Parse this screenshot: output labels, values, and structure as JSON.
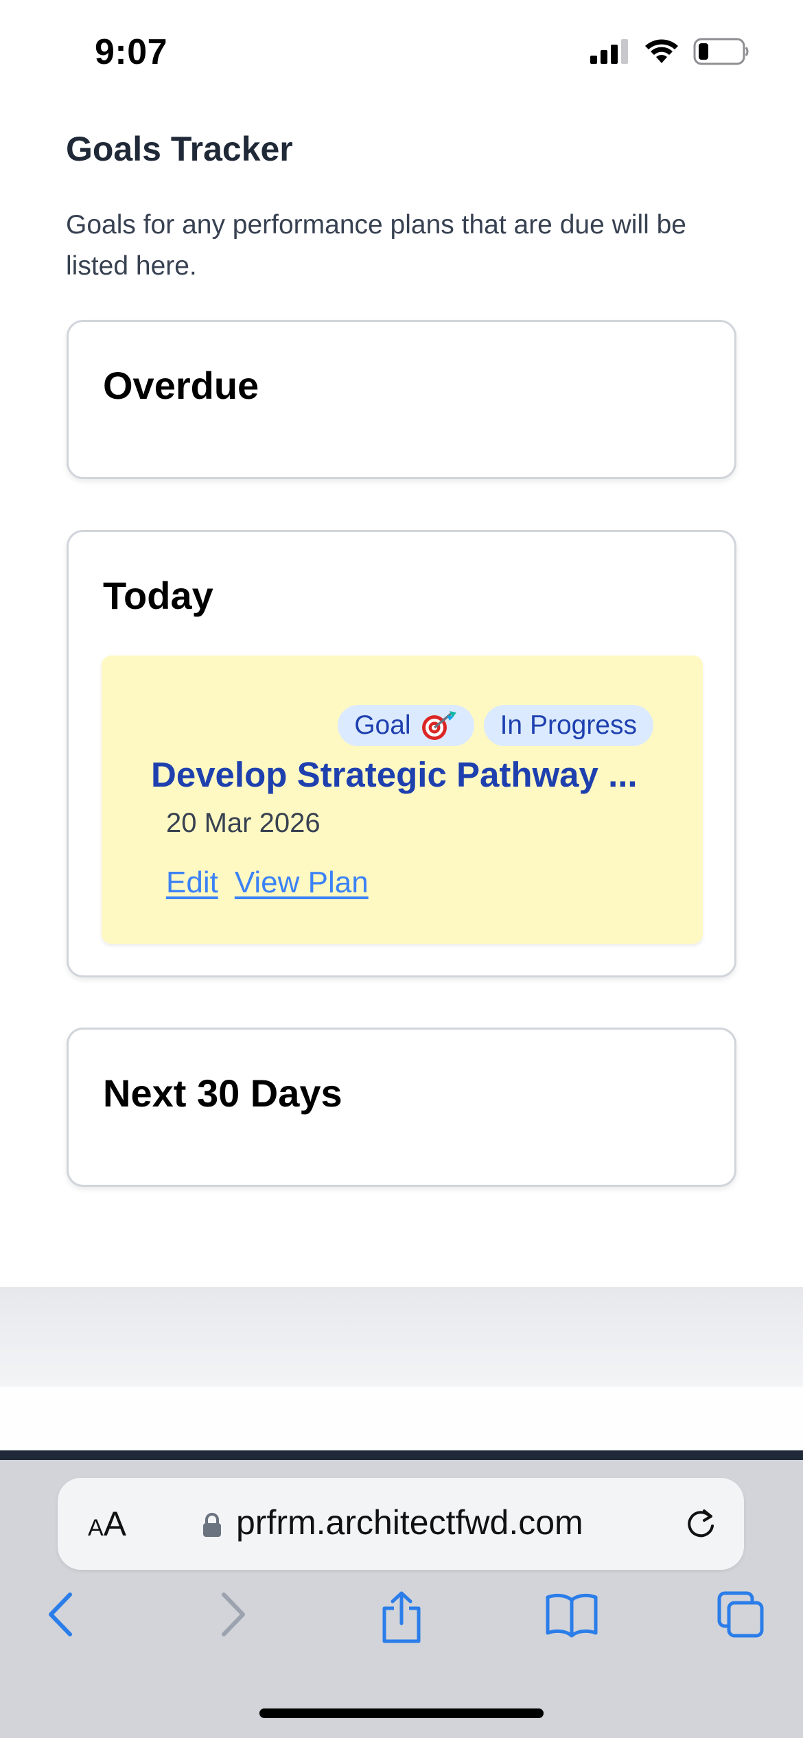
{
  "status_bar": {
    "time": "9:07"
  },
  "page": {
    "title": "Goals Tracker",
    "description": "Goals for any performance plans that are due will be listed here."
  },
  "sections": {
    "overdue": {
      "title": "Overdue"
    },
    "today": {
      "title": "Today",
      "goal": {
        "type_badge": "Goal",
        "status_badge": "In Progress",
        "title": "Develop Strategic Pathway ...",
        "date": "20 Mar 2026",
        "edit_label": "Edit",
        "view_plan_label": "View Plan"
      }
    },
    "next30": {
      "title": "Next 30 Days"
    }
  },
  "browser": {
    "text_size_label_big": "A",
    "text_size_label_small": "A",
    "url": "prfrm.architectfwd.com"
  },
  "colors": {
    "accent_blue": "#1e40af",
    "link_blue": "#3b82f6",
    "goal_bg": "#fef9c3",
    "badge_bg": "#dbeafe",
    "safari_blue": "#2b7de9"
  }
}
